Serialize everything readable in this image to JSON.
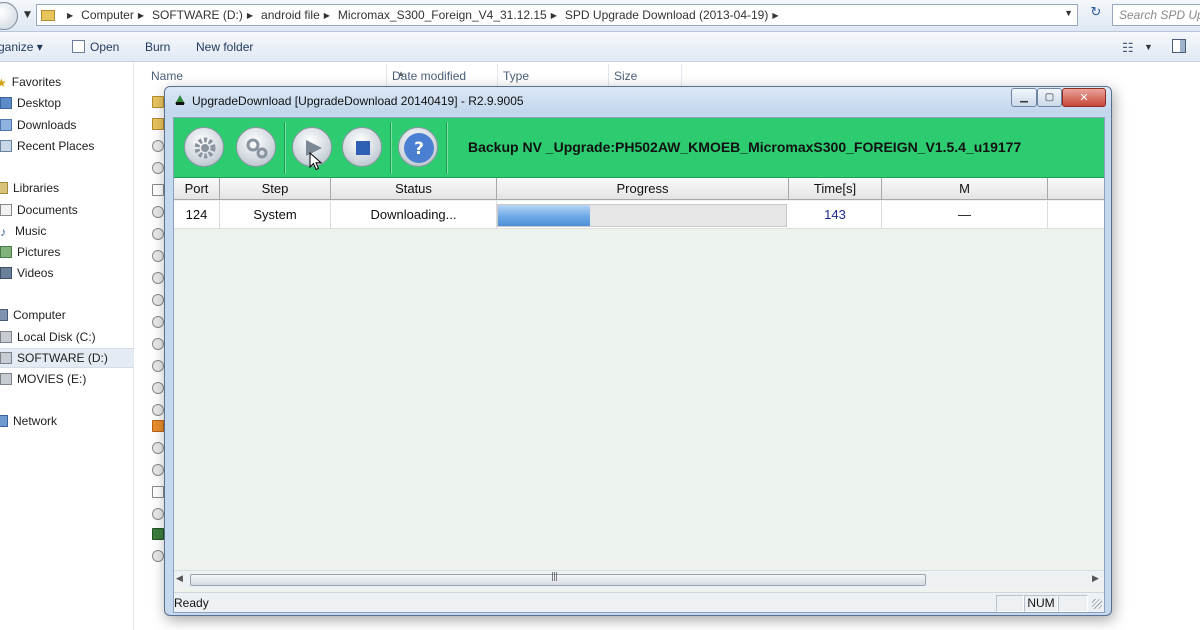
{
  "explorer": {
    "breadcrumb": [
      "Computer",
      "SOFTWARE (D:)",
      "android file",
      "Micromax_S300_Foreign_V4_31.12.15",
      "SPD Upgrade Download (2013-04-19)"
    ],
    "search_placeholder": "Search SPD Upgr",
    "toolbar": {
      "organize": "ganize",
      "open": "Open",
      "burn": "Burn",
      "new_folder": "New folder"
    },
    "sidebar": {
      "favorites": "Favorites",
      "desktop": "Desktop",
      "downloads": "Downloads",
      "recent_places": "Recent Places",
      "libraries": "Libraries",
      "documents": "Documents",
      "music": "Music",
      "pictures": "Pictures",
      "videos": "Videos",
      "computer": "Computer",
      "local_disk": "Local Disk (C:)",
      "software": "SOFTWARE (D:)",
      "movies": "MOVIES (E:)",
      "network": "Network"
    },
    "columns": {
      "name": "Name",
      "date_modified": "Date modified",
      "type": "Type",
      "size": "Size"
    }
  },
  "dialog": {
    "title": "UpgradeDownload [UpgradeDownload 20140419] - R2.9.9005",
    "banner": "Backup NV _Upgrade:PH502AW_KMOEB_MicromaxS300_FOREIGN_V1.5.4_u19177",
    "columns": {
      "port": "Port",
      "step": "Step",
      "status": "Status",
      "progress": "Progress",
      "time": "Time[s]",
      "m": "M"
    },
    "row": {
      "port": "124",
      "step": "System",
      "status": "Downloading...",
      "progress_fraction": 0.32,
      "time": "143",
      "m": "—"
    },
    "status_ready": "Ready",
    "status_num": "NUM",
    "colors": {
      "toolbar": "#2ecc71",
      "progress": "#6ea9e6",
      "time_text": "#1a2a8c"
    }
  }
}
